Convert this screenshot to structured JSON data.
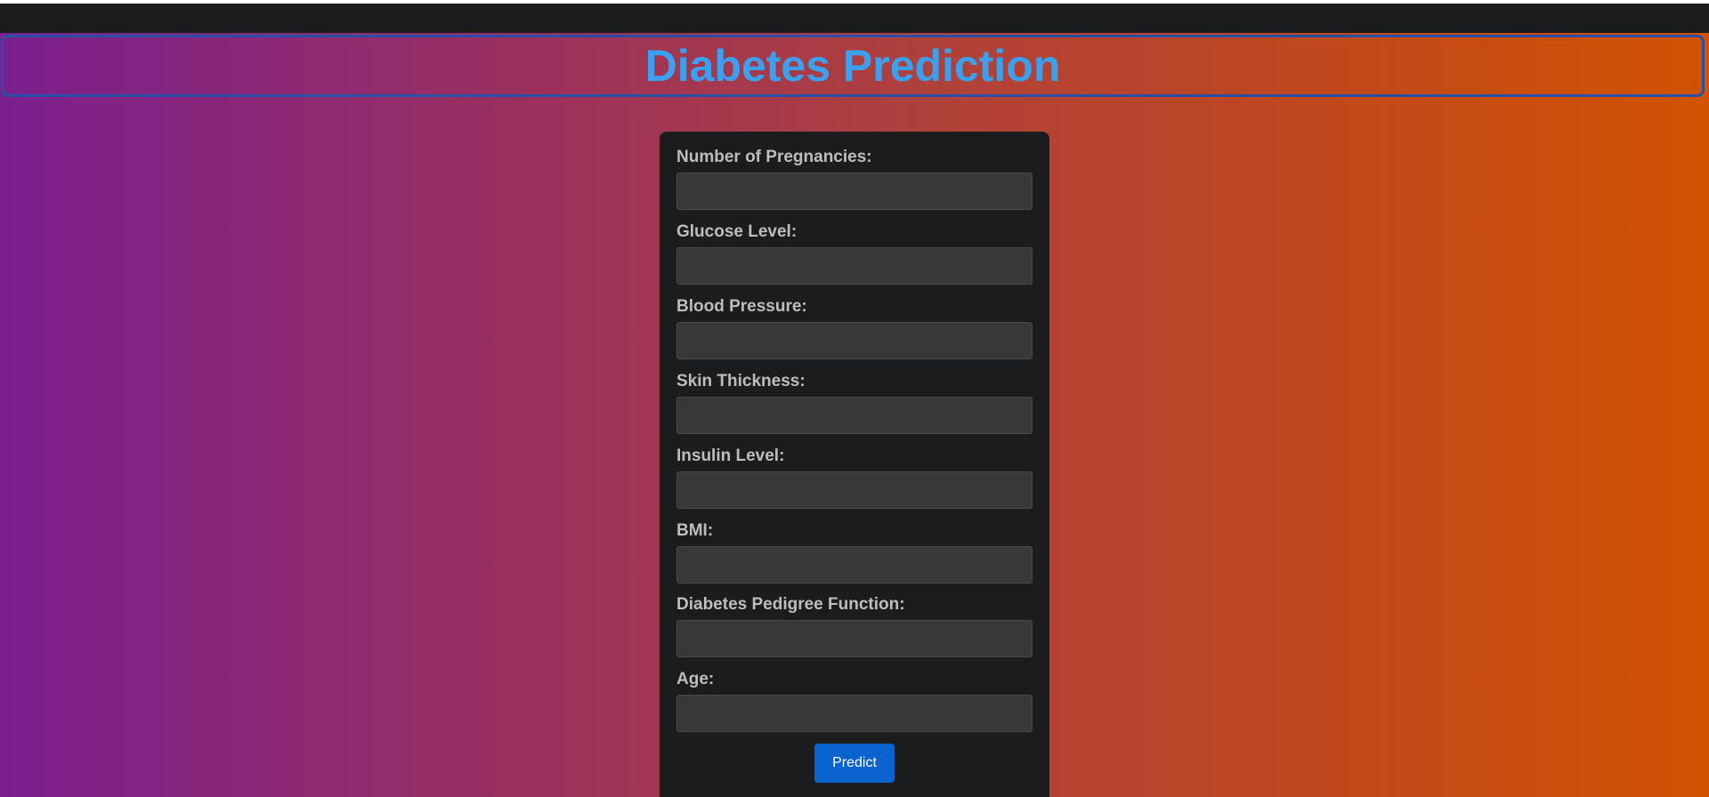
{
  "page": {
    "title": "Diabetes Prediction"
  },
  "form": {
    "fields": [
      {
        "label": "Number of Pregnancies:",
        "value": ""
      },
      {
        "label": "Glucose Level:",
        "value": ""
      },
      {
        "label": "Blood Pressure:",
        "value": ""
      },
      {
        "label": "Skin Thickness:",
        "value": ""
      },
      {
        "label": "Insulin Level:",
        "value": ""
      },
      {
        "label": "BMI:",
        "value": ""
      },
      {
        "label": "Diabetes Pedigree Function:",
        "value": ""
      },
      {
        "label": "Age:",
        "value": ""
      }
    ],
    "submit_label": "Predict"
  },
  "colors": {
    "title": "#3ba1ee",
    "card_background": "#1b1c1e",
    "input_background": "#383838",
    "button": "#0a63cf",
    "gradient_start": "#7b1f8f",
    "gradient_end": "#d15300"
  }
}
